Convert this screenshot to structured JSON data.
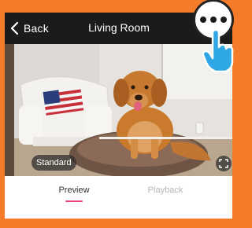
{
  "header": {
    "back_label": "Back",
    "title": "Living Room"
  },
  "player": {
    "quality_label": "Standard"
  },
  "tabs": [
    {
      "label": "Preview",
      "active": true
    },
    {
      "label": "Playback",
      "active": false
    }
  ],
  "icons": {
    "back": "chevron-left-icon",
    "more": "more-dots-icon",
    "pointer": "pointing-hand-icon",
    "mute": "speaker-muted-icon",
    "fullscreen": "fullscreen-icon"
  },
  "colors": {
    "background": "#f47b2a",
    "topbar": "#1b1b1b",
    "accent": "#e5417a",
    "hand": "#2fa7e4"
  }
}
